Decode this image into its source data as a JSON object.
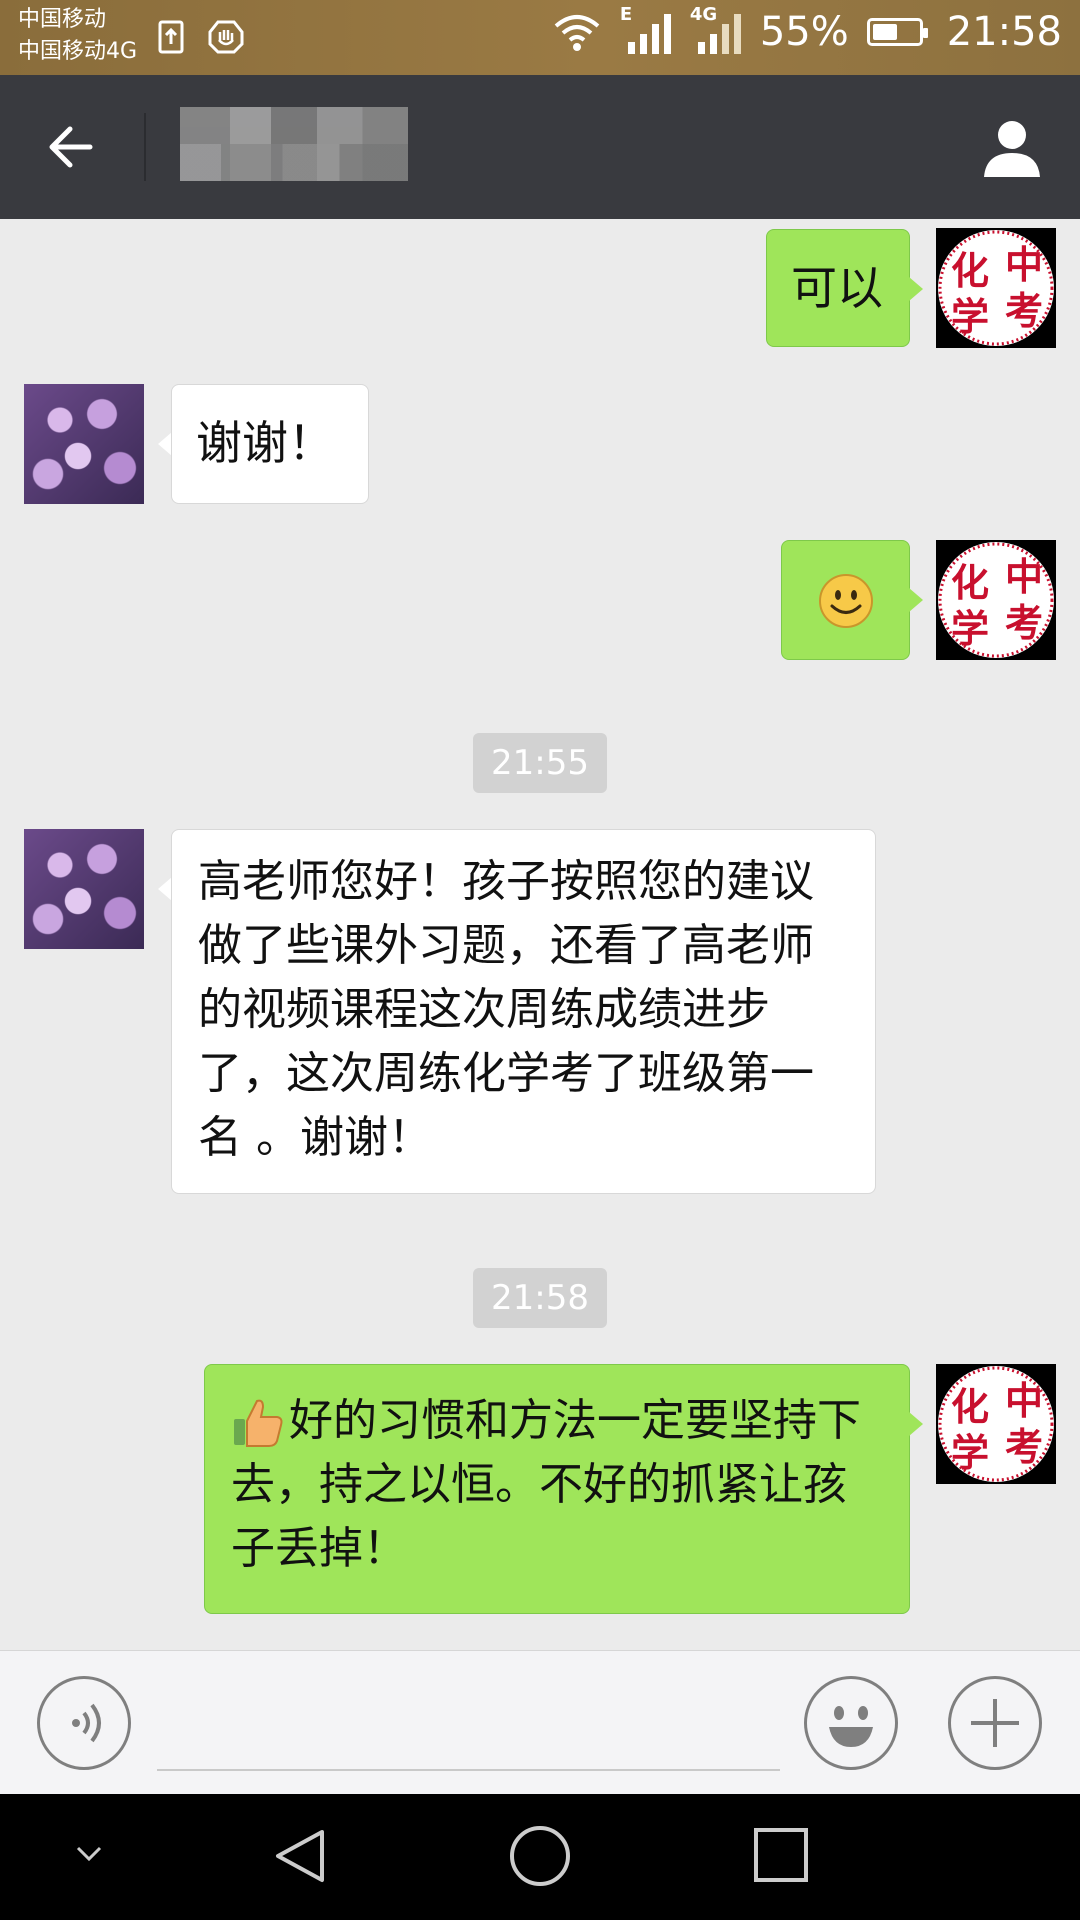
{
  "status_bar": {
    "carrier1": "中国移动",
    "carrier2": "中国移动4G",
    "network_e": "E",
    "network_4g": "4G",
    "battery_percent_text": "55%",
    "battery_level": 0.55,
    "time": "21:58"
  },
  "title_bar": {
    "back_icon": "arrow-left-icon",
    "title": "",
    "contact_icon": "person-icon"
  },
  "messages": [
    {
      "sender": "me",
      "text": "可以"
    },
    {
      "sender": "other",
      "text": "谢谢！"
    },
    {
      "sender": "me",
      "emoji": "smile"
    },
    {
      "type": "time",
      "text": "21:55"
    },
    {
      "sender": "other",
      "text": "高老师您好！孩子按照您的建议做了些课外习题，还看了高老师的视频课程这次周练成绩进步了，这次周练化学考了班级第一名 。谢谢！"
    },
    {
      "type": "time",
      "text": "21:58"
    },
    {
      "sender": "me",
      "prefix_emoji": "thumbs-up",
      "text": "好的习惯和方法一定要坚持下去，持之以恒。不好的抓紧让孩子丢掉！"
    }
  ],
  "avatars": {
    "me_seal_chars": [
      "化",
      "中",
      "学",
      "考"
    ],
    "other": "flower-avatar"
  },
  "input_bar": {
    "voice_icon": "voice-icon",
    "emoji_icon": "emoji-icon",
    "more_icon": "plus-icon",
    "input_value": ""
  },
  "nav_bar": {
    "icons": [
      "chevron-down-icon",
      "back-triangle-icon",
      "home-circle-icon",
      "recents-square-icon"
    ]
  }
}
